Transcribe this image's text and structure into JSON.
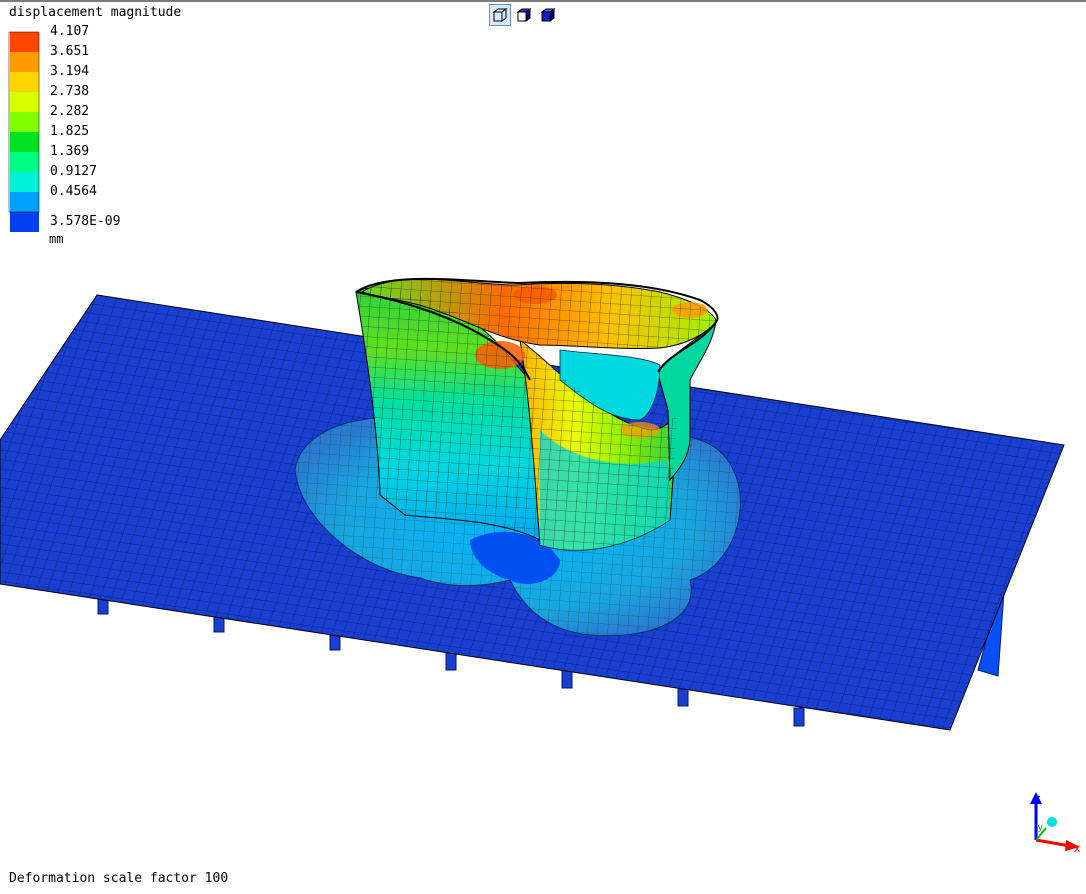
{
  "legend": {
    "title": "displacement magnitude",
    "entries": [
      {
        "label": "4.107",
        "color": "#ff4500"
      },
      {
        "label": "3.651",
        "color": "#ff9a00"
      },
      {
        "label": "3.194",
        "color": "#ffd400"
      },
      {
        "label": "2.738",
        "color": "#d8ff00"
      },
      {
        "label": "2.282",
        "color": "#80ff00"
      },
      {
        "label": "1.825",
        "color": "#00e020"
      },
      {
        "label": "1.369",
        "color": "#00ff80"
      },
      {
        "label": "0.9127",
        "color": "#00f0d8"
      },
      {
        "label": "0.4564",
        "color": "#00a0ff"
      }
    ],
    "min_label": "3.578E-09",
    "min_color": "#0040f0",
    "unit": "mm"
  },
  "toolbar": {
    "buttons": [
      {
        "icon": "wireframe-cube-icon",
        "active": true
      },
      {
        "icon": "shaded-cube-icon",
        "active": false
      },
      {
        "icon": "solid-cube-icon",
        "active": false
      }
    ]
  },
  "axes": {
    "x": "x",
    "y": "y",
    "z": "z"
  },
  "footer": {
    "text": "Deformation scale factor 100"
  },
  "colors": {
    "plate": "#1a3fd0",
    "plate_mesh": "#001a6e",
    "axis_x": "#ff0000",
    "axis_y": "#00c000",
    "axis_z": "#0000ff"
  }
}
